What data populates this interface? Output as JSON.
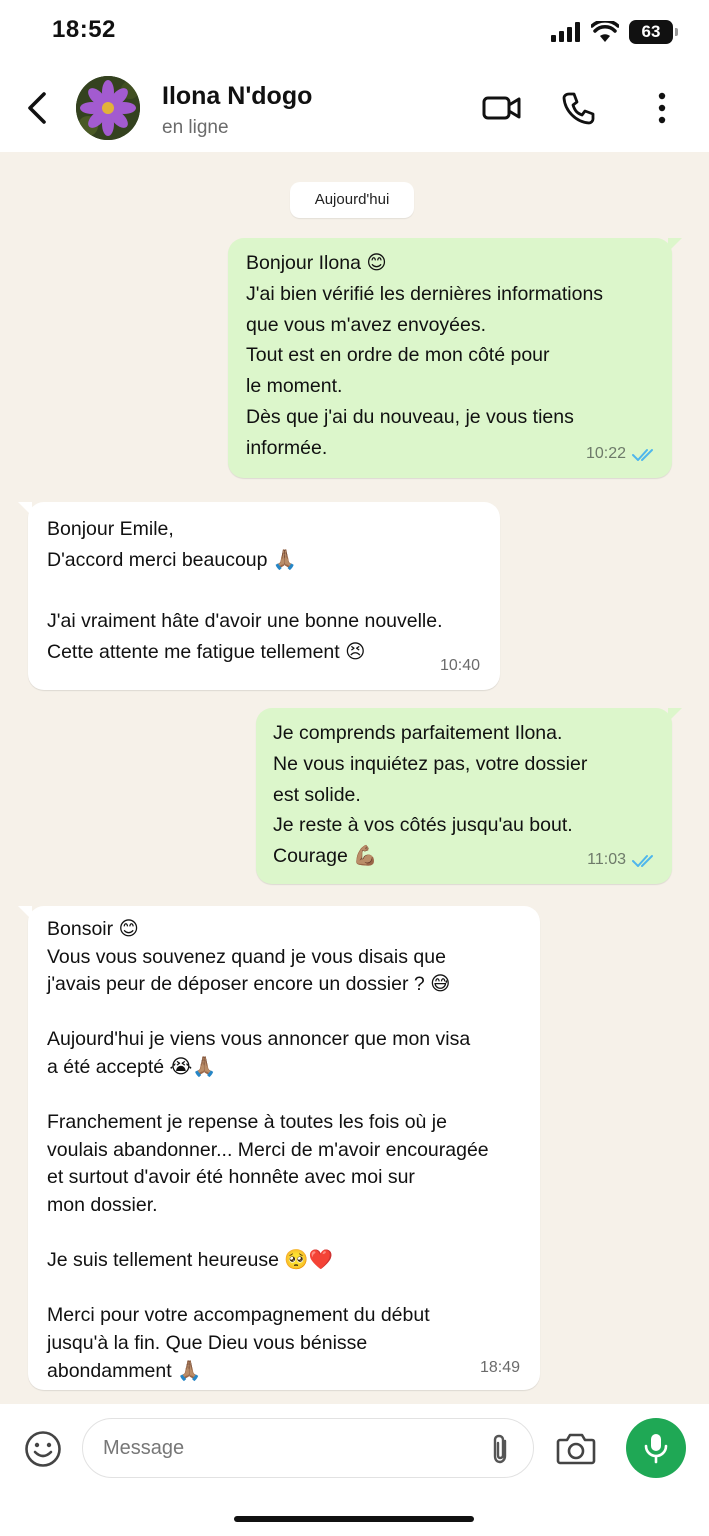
{
  "status_bar": {
    "time": "18:52",
    "battery": "63",
    "icons": [
      "signal-icon",
      "wifi-icon",
      "battery-icon"
    ]
  },
  "header": {
    "back_icon": "chevron-left-icon",
    "avatar": "flower-avatar",
    "contact_name": "Ilona N'dogo",
    "contact_status": "en ligne",
    "actions": [
      "video-call-icon",
      "phone-icon",
      "more-vertical-icon"
    ]
  },
  "chat": {
    "date_label": "Aujourd'hui",
    "messages": [
      {
        "direction": "outgoing",
        "text": "Bonjour Ilona 😊\nJ'ai bien vérifié les dernières informations\nque vous m'avez envoyées.\nTout est en ordre de mon côté pour\nle moment.\nDès que j'ai du nouveau, je vous tiens\ninformée.",
        "time": "10:22",
        "status": "read"
      },
      {
        "direction": "incoming",
        "text": "Bonjour Emile,\nD'accord merci beaucoup 🙏🏽\n\nJ'ai vraiment hâte d'avoir une bonne nouvelle.\nCette attente me fatigue tellement 😣",
        "time": "10:40"
      },
      {
        "direction": "outgoing",
        "text": "Je comprends parfaitement Ilona.\nNe vous inquiétez pas, votre dossier\nest solide.\nJe reste à vos côtés jusqu'au bout.\nCourage 💪🏽",
        "time": "11:03",
        "status": "read"
      },
      {
        "direction": "incoming",
        "text": "Bonsoir 😊\nVous vous souvenez quand je vous disais que\nj'avais peur de déposer encore un dossier ? 😅\n\nAujourd'hui je viens vous annoncer que mon visa\na été accepté 😭🙏🏽\n\nFranchement je repense à toutes les fois où je\nvoulais abandonner... Merci de m'avoir encouragée\net surtout d'avoir été honnête avec moi sur\nmon dossier.\n\nJe suis tellement heureuse 🥺❤️\n\nMerci pour votre accompagnement du début\njusqu'à la fin. Que Dieu vous bénisse\nabondamment 🙏🏽",
        "time": "18:49"
      }
    ]
  },
  "composer": {
    "placeholder": "Message",
    "icons": [
      "emoji-icon",
      "paperclip-icon",
      "camera-icon",
      "microphone-icon"
    ],
    "mic_color": "#1fa855"
  },
  "colors": {
    "outgoing_bubble": "#dcf6cb",
    "incoming_bubble": "#ffffff",
    "chat_background": "#f6f1e9",
    "read_ticks": "#4fb6ec"
  }
}
